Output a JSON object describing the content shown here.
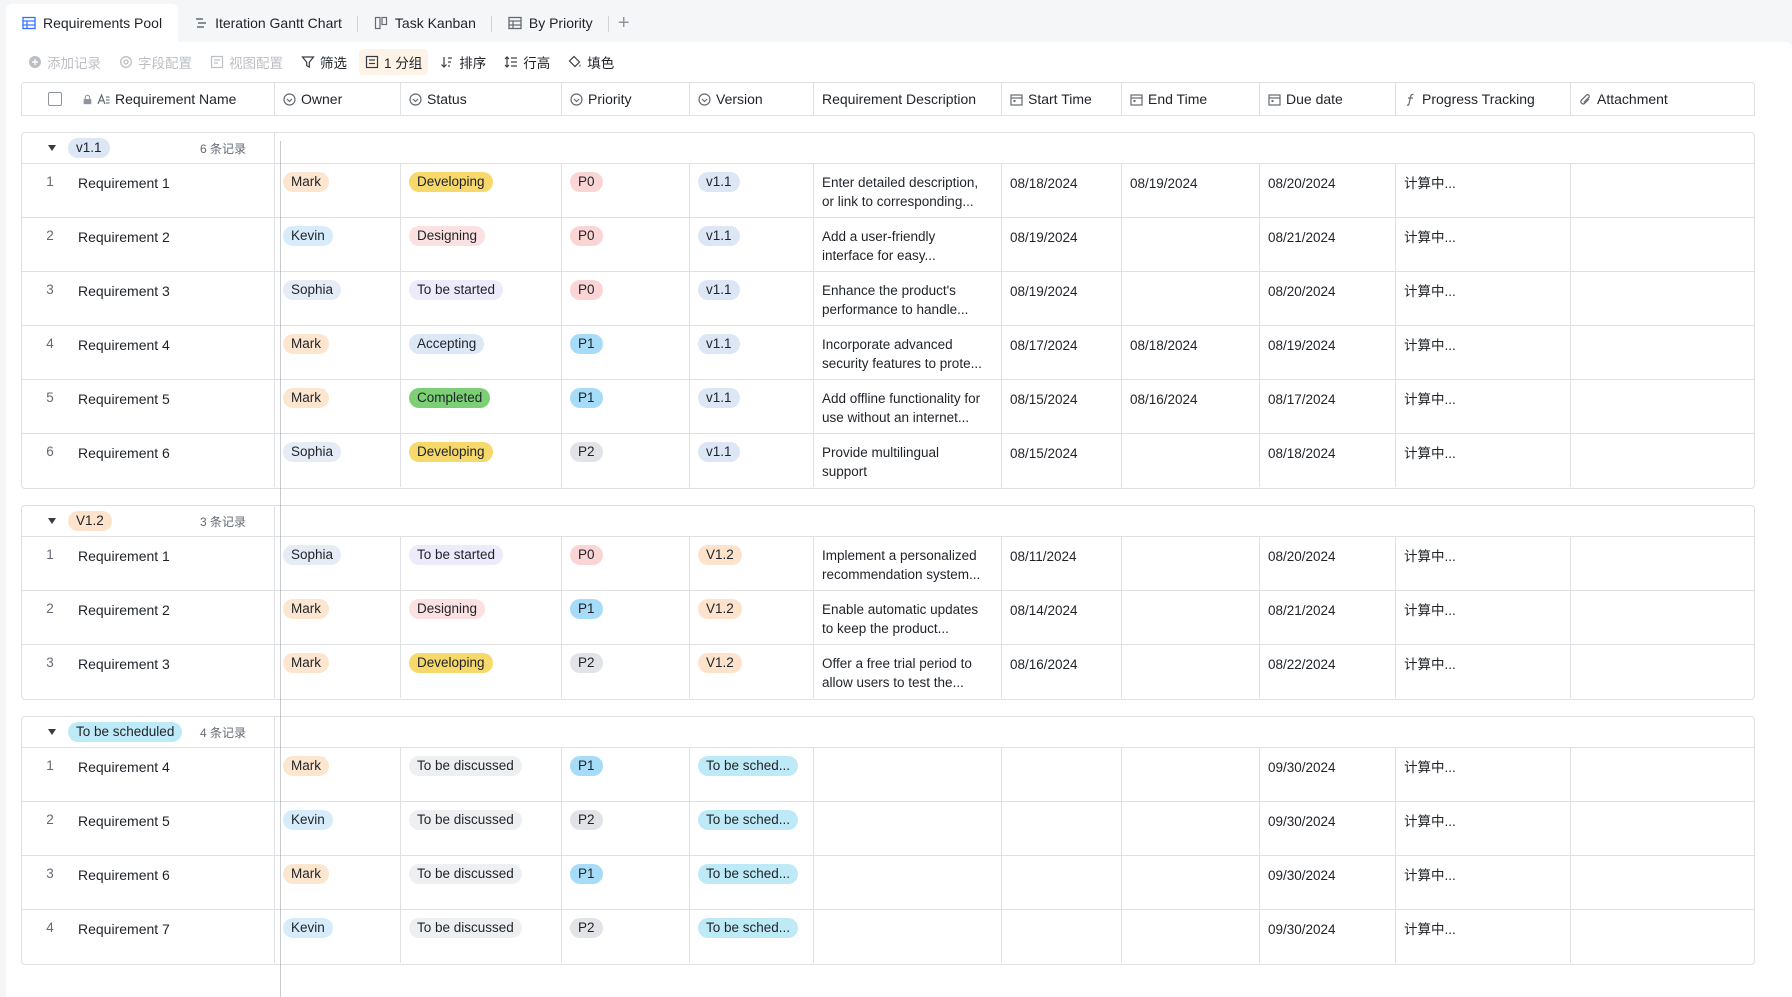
{
  "tabs": [
    {
      "label": "Requirements Pool",
      "icon": "grid-icon",
      "active": true
    },
    {
      "label": "Iteration Gantt Chart",
      "icon": "gantt-icon",
      "active": false
    },
    {
      "label": "Task Kanban",
      "icon": "kanban-icon",
      "active": false
    },
    {
      "label": "By Priority",
      "icon": "grid-icon",
      "active": false
    }
  ],
  "toolbar": {
    "add_record": "添加记录",
    "field_config": "字段配置",
    "view_config": "视图配置",
    "filter": "筛选",
    "group": "1 分组",
    "sort": "排序",
    "row_height": "行高",
    "fill_color": "填色"
  },
  "columns": [
    "Requirement Name",
    "Owner",
    "Status",
    "Priority",
    "Version",
    "Requirement Description",
    "Start Time",
    "End Time",
    "Due date",
    "Progress Tracking",
    "Attachment"
  ],
  "colors": {
    "owner_mark": "#fde6cf",
    "owner_kevin": "#d7ecfb",
    "owner_sophia": "#e6ecf5",
    "status_developing": "#f7d86b",
    "status_designing": "#fbe1e1",
    "status_started": "#eceafb",
    "status_accepting": "#dde8f7",
    "status_completed": "#7ccf74",
    "status_discussed": "#eeeff1",
    "p0": "#fbd5d5",
    "p1": "#a6dcf7",
    "p2": "#e2e3e6",
    "v11": "#dde6f4",
    "v12": "#fde3cb",
    "vsched": "#bdeaf6"
  },
  "groups": [
    {
      "label": "v1.1",
      "count": "6 条记录",
      "tag_color": "#dde6f4",
      "rows": [
        {
          "n": "1",
          "name": "Requirement 1",
          "owner": "Mark",
          "oc": "#fde6cf",
          "status": "Developing",
          "sc": "#f7d86b",
          "priority": "P0",
          "pc": "#fbd5d5",
          "version": "v1.1",
          "vc": "#dde6f4",
          "desc1": "Enter detailed description,",
          "desc2": "or link to corresponding...",
          "start": "08/18/2024",
          "end": "08/19/2024",
          "due": "08/20/2024",
          "progress": "计算中..."
        },
        {
          "n": "2",
          "name": "Requirement 2",
          "owner": "Kevin",
          "oc": "#d7ecfb",
          "status": "Designing",
          "sc": "#fbe1e1",
          "priority": "P0",
          "pc": "#fbd5d5",
          "version": "v1.1",
          "vc": "#dde6f4",
          "desc1": "Add a user-friendly",
          "desc2": "interface for easy...",
          "start": "08/19/2024",
          "end": "",
          "due": "08/21/2024",
          "progress": "计算中..."
        },
        {
          "n": "3",
          "name": "Requirement 3",
          "owner": "Sophia",
          "oc": "#e6ecf5",
          "status": "To be started",
          "sc": "#eceafb",
          "priority": "P0",
          "pc": "#fbd5d5",
          "version": "v1.1",
          "vc": "#dde6f4",
          "desc1": "Enhance the product's",
          "desc2": "performance to handle...",
          "start": "08/19/2024",
          "end": "",
          "due": "08/20/2024",
          "progress": "计算中..."
        },
        {
          "n": "4",
          "name": "Requirement 4",
          "owner": "Mark",
          "oc": "#fde6cf",
          "status": "Accepting",
          "sc": "#dde8f7",
          "priority": "P1",
          "pc": "#a6dcf7",
          "version": "v1.1",
          "vc": "#dde6f4",
          "desc1": "Incorporate advanced",
          "desc2": "security features to prote...",
          "start": "08/17/2024",
          "end": "08/18/2024",
          "due": "08/19/2024",
          "progress": "计算中..."
        },
        {
          "n": "5",
          "name": "Requirement 5",
          "owner": "Mark",
          "oc": "#fde6cf",
          "status": "Completed",
          "sc": "#7ccf74",
          "priority": "P1",
          "pc": "#a6dcf7",
          "version": "v1.1",
          "vc": "#dde6f4",
          "desc1": "Add offline functionality for",
          "desc2": "use without an internet...",
          "start": "08/15/2024",
          "end": "08/16/2024",
          "due": "08/17/2024",
          "progress": "计算中..."
        },
        {
          "n": "6",
          "name": "Requirement 6",
          "owner": "Sophia",
          "oc": "#e6ecf5",
          "status": "Developing",
          "sc": "#f7d86b",
          "priority": "P2",
          "pc": "#e2e3e6",
          "version": "v1.1",
          "vc": "#dde6f4",
          "desc1": "Provide multilingual",
          "desc2": "support",
          "start": "08/15/2024",
          "end": "",
          "due": "08/18/2024",
          "progress": "计算中..."
        }
      ]
    },
    {
      "label": "V1.2",
      "count": "3 条记录",
      "tag_color": "#fde3cb",
      "rows": [
        {
          "n": "1",
          "name": "Requirement 1",
          "owner": "Sophia",
          "oc": "#e6ecf5",
          "status": "To be started",
          "sc": "#eceafb",
          "priority": "P0",
          "pc": "#fbd5d5",
          "version": "V1.2",
          "vc": "#fde3cb",
          "desc1": "Implement a personalized",
          "desc2": "recommendation system...",
          "start": "08/11/2024",
          "end": "",
          "due": "08/20/2024",
          "progress": "计算中..."
        },
        {
          "n": "2",
          "name": "Requirement 2",
          "owner": "Mark",
          "oc": "#fde6cf",
          "status": "Designing",
          "sc": "#fbe1e1",
          "priority": "P1",
          "pc": "#a6dcf7",
          "version": "V1.2",
          "vc": "#fde3cb",
          "desc1": "Enable automatic updates",
          "desc2": "to keep the product...",
          "start": "08/14/2024",
          "end": "",
          "due": "08/21/2024",
          "progress": "计算中..."
        },
        {
          "n": "3",
          "name": "Requirement 3",
          "owner": "Mark",
          "oc": "#fde6cf",
          "status": "Developing",
          "sc": "#f7d86b",
          "priority": "P2",
          "pc": "#e2e3e6",
          "version": "V1.2",
          "vc": "#fde3cb",
          "desc1": "Offer a free trial period to",
          "desc2": "allow users to test the...",
          "start": "08/16/2024",
          "end": "",
          "due": "08/22/2024",
          "progress": "计算中..."
        }
      ]
    },
    {
      "label": "To be scheduled",
      "count": "4 条记录",
      "tag_color": "#bdeaf6",
      "rows": [
        {
          "n": "1",
          "name": "Requirement 4",
          "owner": "Mark",
          "oc": "#fde6cf",
          "status": "To be discussed",
          "sc": "#eeeff1",
          "priority": "P1",
          "pc": "#a6dcf7",
          "version": "To be sched...",
          "vc": "#bdeaf6",
          "desc1": "",
          "desc2": "",
          "start": "",
          "end": "",
          "due": "09/30/2024",
          "progress": "计算中..."
        },
        {
          "n": "2",
          "name": "Requirement 5",
          "owner": "Kevin",
          "oc": "#d7ecfb",
          "status": "To be discussed",
          "sc": "#eeeff1",
          "priority": "P2",
          "pc": "#e2e3e6",
          "version": "To be sched...",
          "vc": "#bdeaf6",
          "desc1": "",
          "desc2": "",
          "start": "",
          "end": "",
          "due": "09/30/2024",
          "progress": "计算中..."
        },
        {
          "n": "3",
          "name": "Requirement 6",
          "owner": "Mark",
          "oc": "#fde6cf",
          "status": "To be discussed",
          "sc": "#eeeff1",
          "priority": "P1",
          "pc": "#a6dcf7",
          "version": "To be sched...",
          "vc": "#bdeaf6",
          "desc1": "",
          "desc2": "",
          "start": "",
          "end": "",
          "due": "09/30/2024",
          "progress": "计算中..."
        },
        {
          "n": "4",
          "name": "Requirement 7",
          "owner": "Kevin",
          "oc": "#d7ecfb",
          "status": "To be discussed",
          "sc": "#eeeff1",
          "priority": "P2",
          "pc": "#e2e3e6",
          "version": "To be sched...",
          "vc": "#bdeaf6",
          "desc1": "",
          "desc2": "",
          "start": "",
          "end": "",
          "due": "09/30/2024",
          "progress": "计算中..."
        }
      ]
    }
  ]
}
